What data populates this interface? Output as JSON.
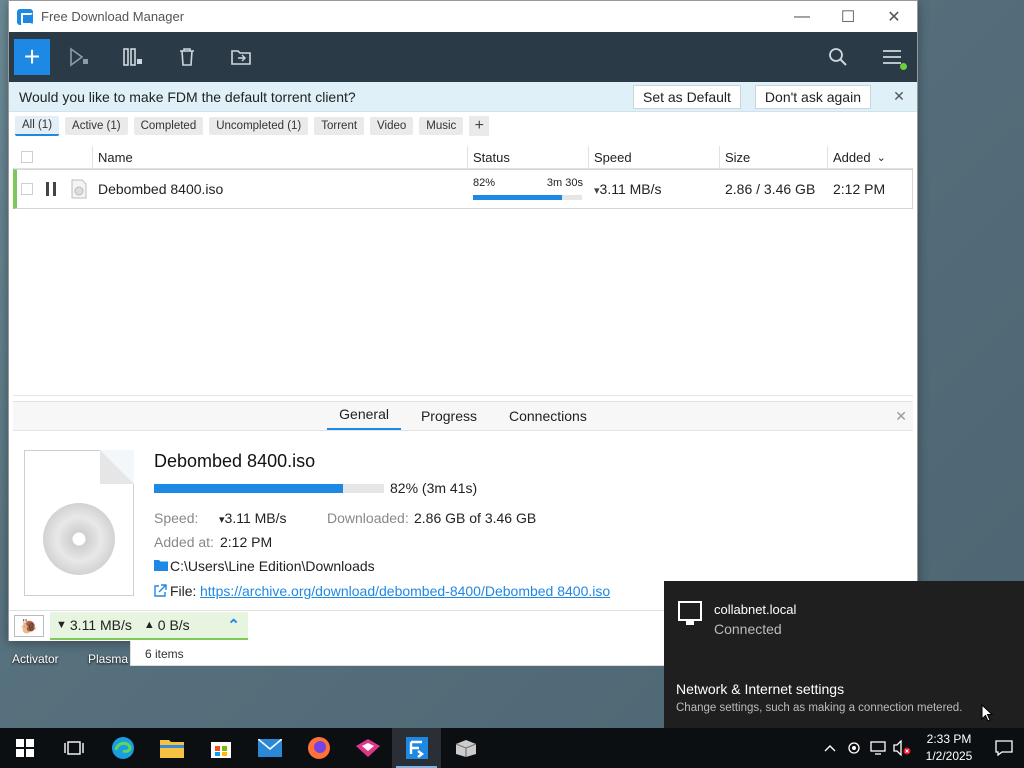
{
  "window": {
    "title": "Free Download Manager",
    "controls": {
      "minimize": "—",
      "maximize": "☐",
      "close": "✕"
    }
  },
  "toolbar": {
    "add_label": "+"
  },
  "banner": {
    "text": "Would you like to make FDM the default torrent client?",
    "set_default": "Set as Default",
    "dont_ask": "Don't ask again",
    "close": "✕"
  },
  "filters": [
    {
      "label": "All (1)",
      "active": true
    },
    {
      "label": "Active (1)",
      "active": false
    },
    {
      "label": "Completed",
      "active": false
    },
    {
      "label": "Uncompleted (1)",
      "active": false
    },
    {
      "label": "Torrent",
      "active": false
    },
    {
      "label": "Video",
      "active": false
    },
    {
      "label": "Music",
      "active": false
    }
  ],
  "filter_add": "+",
  "table": {
    "headers": {
      "name": "Name",
      "status": "Status",
      "speed": "Speed",
      "size": "Size",
      "added": "Added"
    },
    "sort_indicator": "⌄",
    "rows": [
      {
        "name": "Debombed 8400.iso",
        "status_pct": "82%",
        "status_eta": "3m 30s",
        "progress": 0.82,
        "speed": "3.11 MB/s",
        "speed_arrow": "▾",
        "size": "2.86 / 3.46 GB",
        "added": "2:12 PM"
      }
    ]
  },
  "details": {
    "tabs": {
      "general": "General",
      "progress": "Progress",
      "connections": "Connections"
    },
    "close": "✕",
    "file_name": "Debombed 8400.iso",
    "progress": 0.82,
    "progress_text": "82% (3m 41s)",
    "speed_label": "Speed:",
    "speed_arrow": "▾",
    "speed_value": "3.11 MB/s",
    "downloaded_label": "Downloaded:",
    "downloaded_value": "2.86 GB of 3.46 GB",
    "added_label": "Added at:",
    "added_value": "2:12 PM",
    "folder_path": "C:\\Users\\Line Edition\\Downloads",
    "file_label": "File:",
    "file_url": "https://archive.org/download/debombed-8400/Debombed 8400.iso"
  },
  "statusbar": {
    "down_arrow": "▼",
    "down_speed": "3.11 MB/s",
    "up_arrow": "▲",
    "up_speed": "0 B/s",
    "expand": "⌃"
  },
  "items_count": "6 items",
  "desktop_icons": {
    "activator": "Activator",
    "plasma": "Plasma"
  },
  "network_flyout": {
    "network_name": "collabnet.local",
    "network_status": "Connected",
    "settings_title": "Network & Internet settings",
    "settings_sub": "Change settings, such as making a connection metered."
  },
  "taskbar": {
    "time": "2:33 PM",
    "date": "1/2/2025",
    "apps": [
      "windows-start-icon",
      "task-view-icon",
      "edge-icon",
      "file-explorer-icon",
      "store-icon",
      "mail-icon",
      "firefox-icon",
      "game-icon",
      "fdm-icon",
      "app-icon"
    ]
  },
  "colors": {
    "accent": "#1e88e5",
    "toolbar_bg": "#2b3a47",
    "active_green": "#7ec85a",
    "banner_bg": "#dff0f9"
  }
}
